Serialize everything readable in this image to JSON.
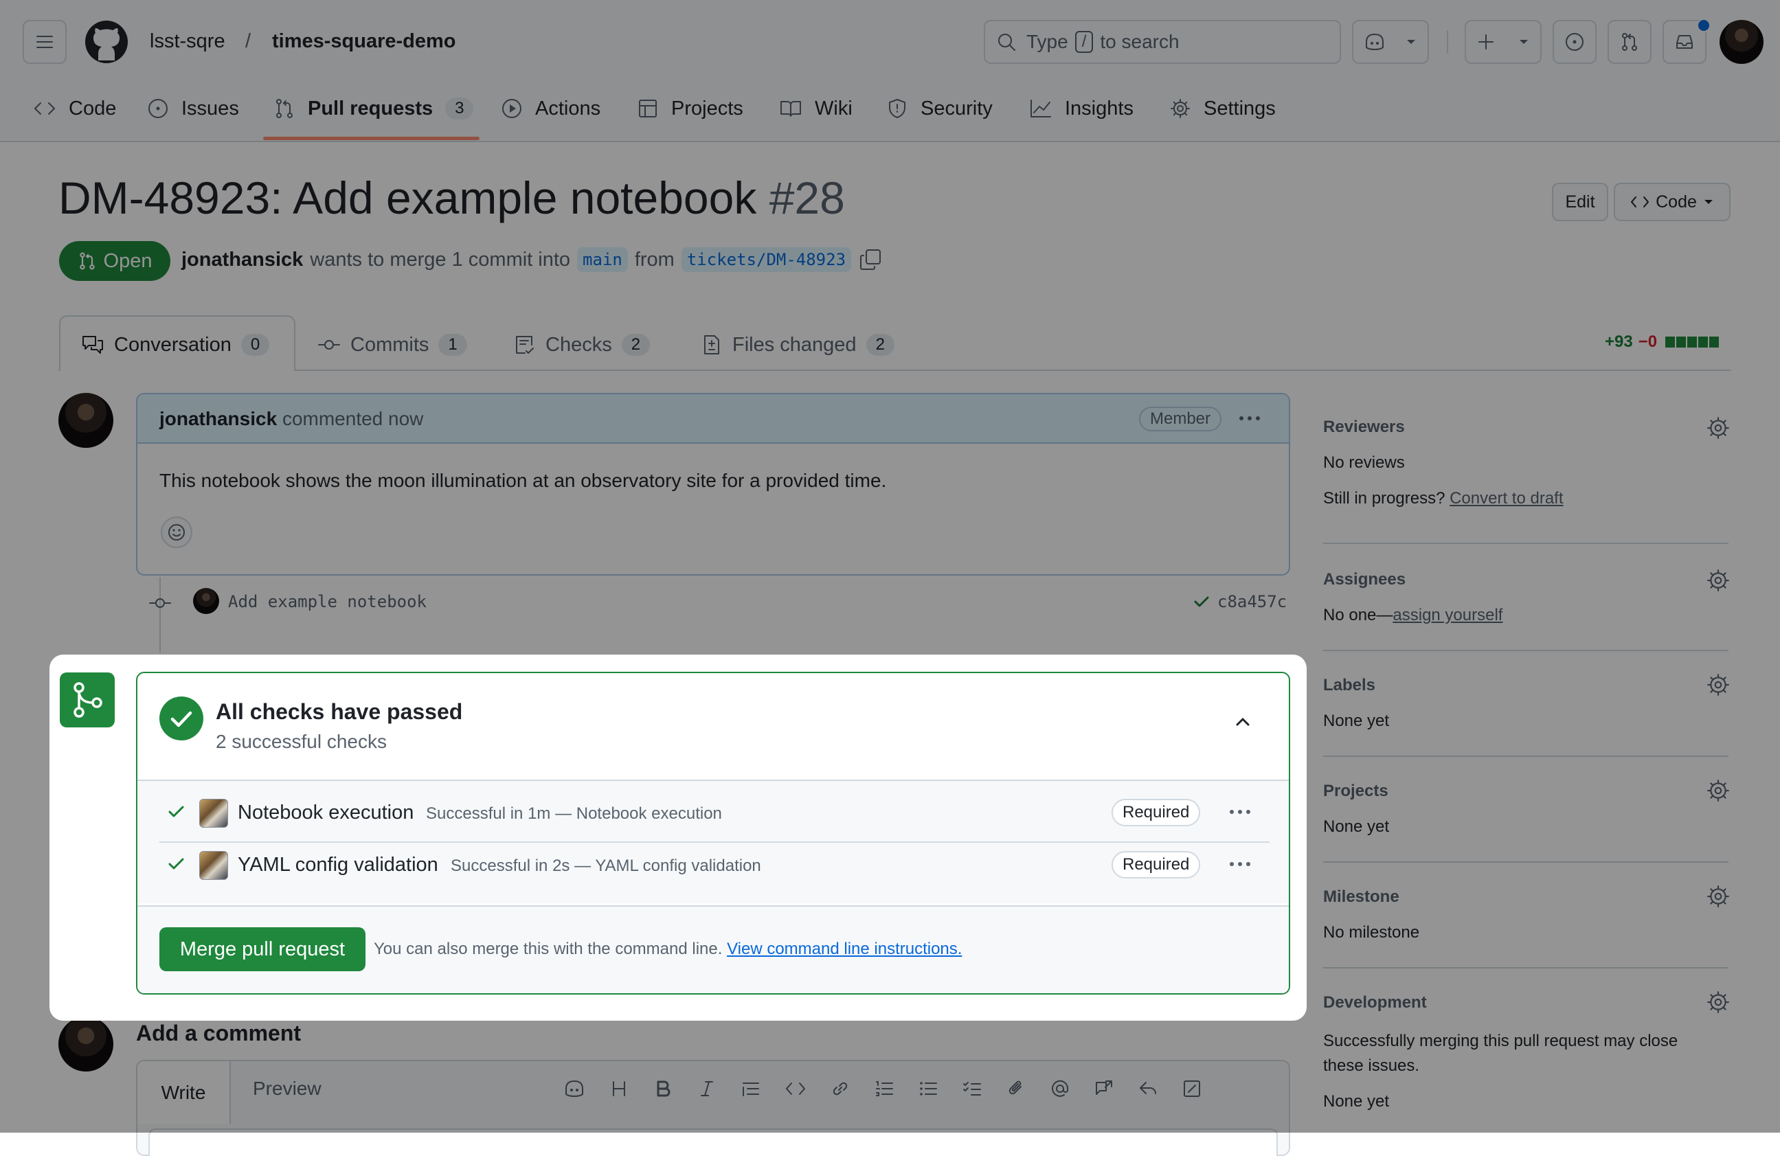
{
  "header": {
    "owner": "lsst-sqre",
    "separator": "/",
    "repo": "times-square-demo",
    "search": {
      "prefix": "Type",
      "key": "/",
      "suffix": "to search"
    }
  },
  "repo_tabs": [
    {
      "label": "Code"
    },
    {
      "label": "Issues"
    },
    {
      "label": "Pull requests",
      "count": "3"
    },
    {
      "label": "Actions"
    },
    {
      "label": "Projects"
    },
    {
      "label": "Wiki"
    },
    {
      "label": "Security"
    },
    {
      "label": "Insights"
    },
    {
      "label": "Settings"
    }
  ],
  "pr": {
    "title": "DM-48923: Add example notebook",
    "number": "#28",
    "state": "Open",
    "author": "jonathansick",
    "merge_text": "wants to merge 1 commit into",
    "base": "main",
    "from_text": "from",
    "head": "tickets/DM-48923",
    "edit_label": "Edit",
    "code_label": "Code"
  },
  "pr_tabs": [
    {
      "label": "Conversation",
      "count": "0"
    },
    {
      "label": "Commits",
      "count": "1"
    },
    {
      "label": "Checks",
      "count": "2"
    },
    {
      "label": "Files changed",
      "count": "2"
    }
  ],
  "diffstat": {
    "additions": "+93",
    "deletions": "−0"
  },
  "comment": {
    "author": "jonathansick",
    "action": "commented now",
    "badge": "Member",
    "body": "This notebook shows the moon illumination at an observatory site for a provided time."
  },
  "commit": {
    "message": "Add example notebook",
    "sha": "c8a457c"
  },
  "checks": {
    "title": "All checks have passed",
    "subtitle": "2 successful checks",
    "items": [
      {
        "name": "Notebook execution",
        "detail": "Successful in 1m — Notebook execution",
        "badge": "Required"
      },
      {
        "name": "YAML config validation",
        "detail": "Successful in 2s — YAML config validation",
        "badge": "Required"
      }
    ],
    "merge_label": "Merge pull request",
    "merge_hint": "You can also merge this with the command line.",
    "merge_link": "View command line instructions."
  },
  "add_comment": {
    "title": "Add a comment",
    "tab_write": "Write",
    "tab_preview": "Preview"
  },
  "sidebar": {
    "reviewers": {
      "title": "Reviewers",
      "text": "No reviews",
      "prompt": "Still in progress?",
      "link": "Convert to draft"
    },
    "assignees": {
      "title": "Assignees",
      "text": "No one—",
      "link": "assign yourself"
    },
    "labels": {
      "title": "Labels",
      "text": "None yet"
    },
    "projects": {
      "title": "Projects",
      "text": "None yet"
    },
    "milestone": {
      "title": "Milestone",
      "text": "No milestone"
    },
    "development": {
      "title": "Development",
      "line1": "Successfully merging this pull request may close",
      "line2": "these issues.",
      "text": "None yet"
    }
  },
  "colors": {
    "success": "#1f883d",
    "accent": "#0969da",
    "danger": "#d1242f"
  }
}
